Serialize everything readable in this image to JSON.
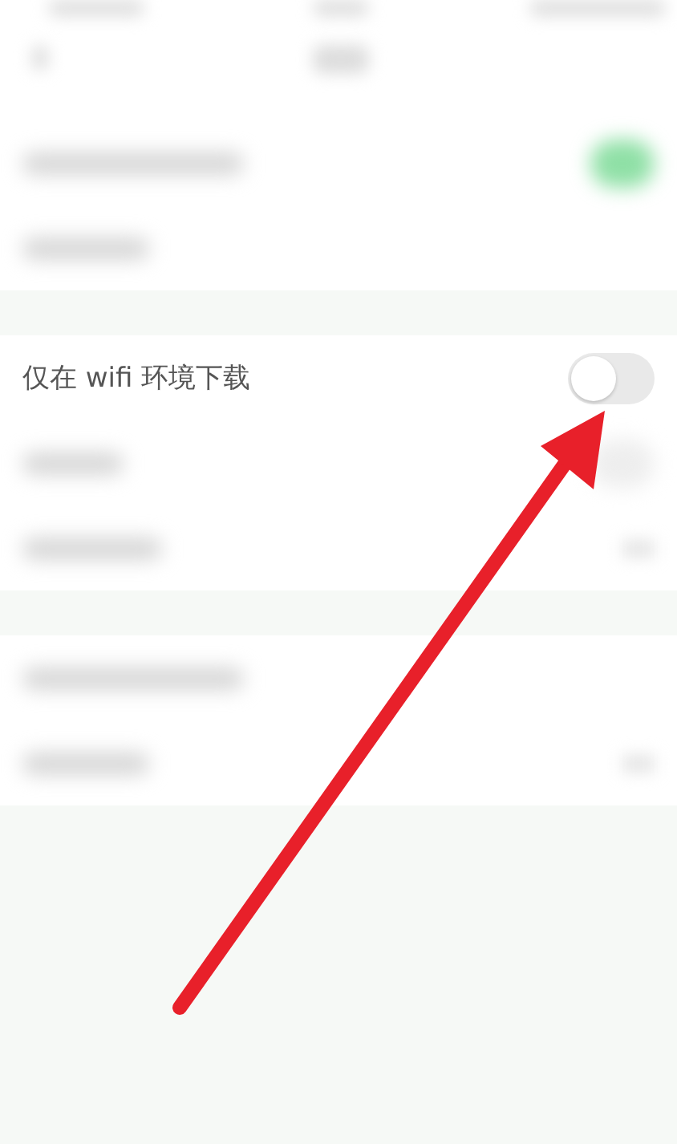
{
  "header": {
    "kind": "blurred"
  },
  "sections": [
    {
      "rows": [
        {
          "kind": "toggle",
          "on": true
        },
        {
          "kind": "blank"
        }
      ]
    },
    {
      "rows": [
        {
          "kind": "setting",
          "label": "仅在 wifi 环境下载",
          "on": false
        },
        {
          "kind": "toggle",
          "on": false
        },
        {
          "kind": "link"
        }
      ]
    },
    {
      "rows": [
        {
          "kind": "blank"
        },
        {
          "kind": "link"
        }
      ]
    }
  ],
  "annotation": {
    "kind": "arrow"
  }
}
